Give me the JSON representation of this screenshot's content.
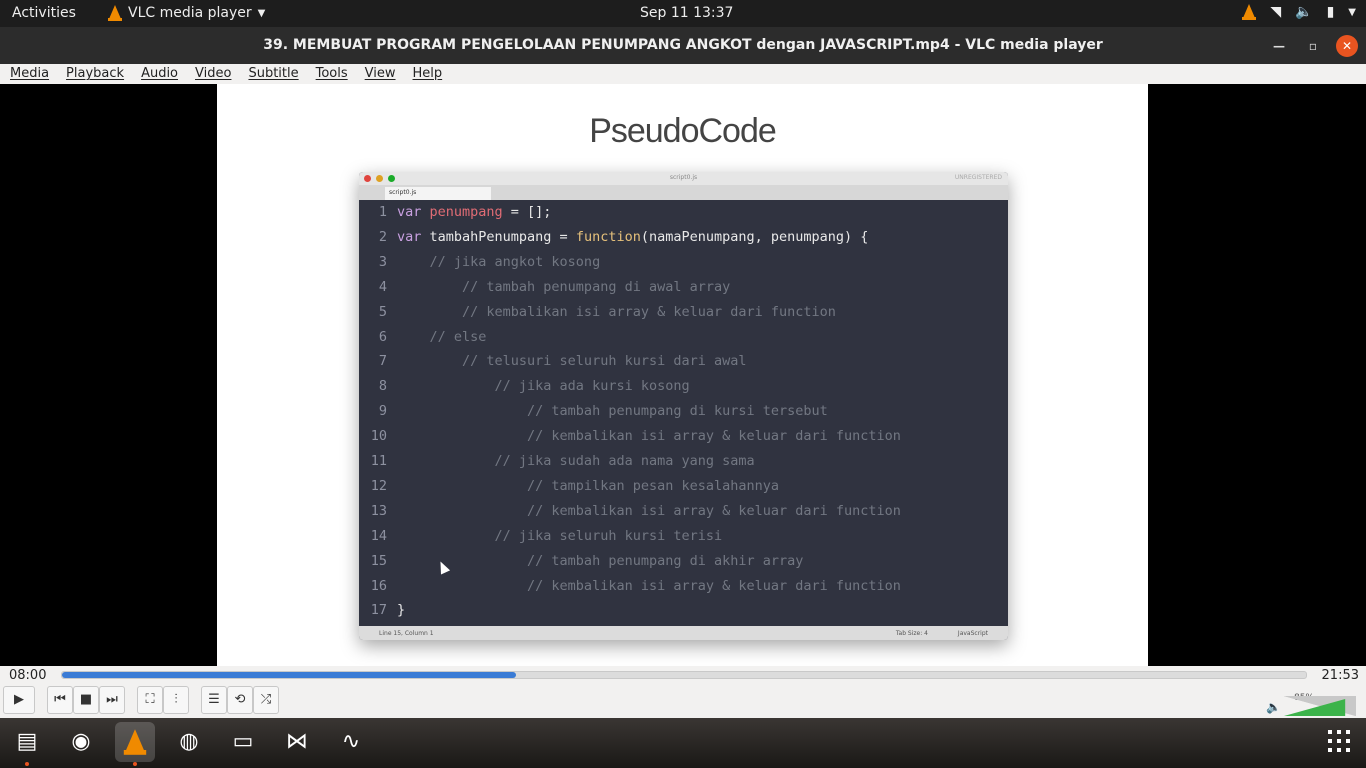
{
  "topbar": {
    "activities": "Activities",
    "app_name": "VLC media player",
    "clock": "Sep 11  13:37"
  },
  "window": {
    "title": "39. MEMBUAT PROGRAM PENGELOLAAN PENUMPANG ANGKOT dengan JAVASCRIPT.mp4 - VLC media player"
  },
  "menu": [
    "Media",
    "Playback",
    "Audio",
    "Video",
    "Subtitle",
    "Tools",
    "View",
    "Help"
  ],
  "slide": {
    "heading": "PseudoCode",
    "editor": {
      "title": "script0.js",
      "registration": "UNREGISTERED",
      "tab": "script0.js",
      "status_left": "Line 15, Column 1",
      "status_tab": "Tab Size: 4",
      "status_lang": "JavaScript",
      "lines": [
        {
          "n": "1",
          "tokens": [
            {
              "c": "kw",
              "t": "var "
            },
            {
              "c": "var",
              "t": "penumpang"
            },
            {
              "c": "txt0",
              "t": " = [];"
            }
          ]
        },
        {
          "n": "2",
          "tokens": [
            {
              "c": "kw",
              "t": "var "
            },
            {
              "c": "txt0",
              "t": "tambahPenumpang = "
            },
            {
              "c": "fn",
              "t": "function"
            },
            {
              "c": "txt0",
              "t": "(namaPenumpang, penumpang) {"
            }
          ]
        },
        {
          "n": "3",
          "tokens": [
            {
              "c": "cm",
              "t": "    // jika angkot kosong"
            }
          ]
        },
        {
          "n": "4",
          "tokens": [
            {
              "c": "cm",
              "t": "        // tambah penumpang di awal array"
            }
          ]
        },
        {
          "n": "5",
          "tokens": [
            {
              "c": "cm",
              "t": "        // kembalikan isi array & keluar dari function"
            }
          ]
        },
        {
          "n": "6",
          "tokens": [
            {
              "c": "cm",
              "t": "    // else"
            }
          ]
        },
        {
          "n": "7",
          "tokens": [
            {
              "c": "cm",
              "t": "        // telusuri seluruh kursi dari awal"
            }
          ]
        },
        {
          "n": "8",
          "tokens": [
            {
              "c": "cm",
              "t": "            // jika ada kursi kosong"
            }
          ]
        },
        {
          "n": "9",
          "tokens": [
            {
              "c": "cm",
              "t": "                // tambah penumpang di kursi tersebut"
            }
          ]
        },
        {
          "n": "10",
          "tokens": [
            {
              "c": "cm",
              "t": "                // kembalikan isi array & keluar dari function"
            }
          ]
        },
        {
          "n": "11",
          "tokens": [
            {
              "c": "cm",
              "t": "            // jika sudah ada nama yang sama"
            }
          ]
        },
        {
          "n": "12",
          "tokens": [
            {
              "c": "cm",
              "t": "                // tampilkan pesan kesalahannya"
            }
          ]
        },
        {
          "n": "13",
          "tokens": [
            {
              "c": "cm",
              "t": "                // kembalikan isi array & keluar dari function"
            }
          ]
        },
        {
          "n": "14",
          "tokens": [
            {
              "c": "cm",
              "t": "            // jika seluruh kursi terisi"
            }
          ]
        },
        {
          "n": "15",
          "tokens": [
            {
              "c": "cm",
              "t": "                // tambah penumpang di akhir array"
            }
          ]
        },
        {
          "n": "16",
          "tokens": [
            {
              "c": "cm",
              "t": "                // kembalikan isi array & keluar dari function"
            }
          ]
        },
        {
          "n": "17",
          "tokens": [
            {
              "c": "txt0",
              "t": "}"
            }
          ]
        }
      ]
    }
  },
  "player": {
    "elapsed": "08:00",
    "total": "21:53",
    "progress": 0.365,
    "volume": "85%"
  },
  "icons": {
    "prev": "skip-back-icon",
    "stop": "stop-icon",
    "next": "skip-forward-icon",
    "play": "play-icon",
    "fullscreen": "fullscreen-icon",
    "extended": "equalizer-icon",
    "playlist": "playlist-icon",
    "loop": "loop-icon",
    "shuffle": "shuffle-icon"
  },
  "dock": [
    "files-icon",
    "firefox-icon",
    "vlc-icon",
    "chrome-icon",
    "terminal-icon",
    "vscode-icon",
    "system-monitor-icon"
  ]
}
